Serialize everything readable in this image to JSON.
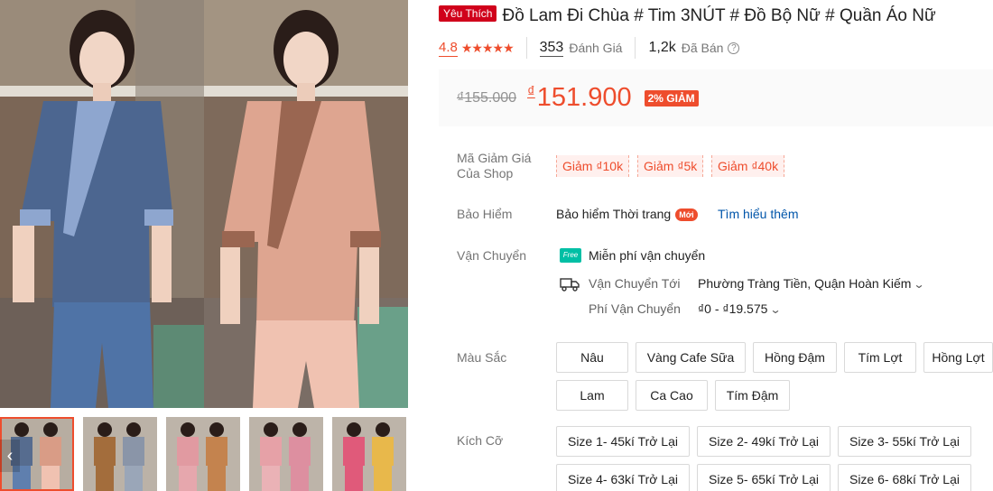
{
  "gallery": {
    "thumb_prev_icon": "chevron-left-icon",
    "thumbnails": [
      {
        "colors": [
          "#566c8f",
          "#d99c86"
        ]
      },
      {
        "colors": [
          "#a36d3c",
          "#8a95a8"
        ]
      },
      {
        "colors": [
          "#e19aa1",
          "#c4834e"
        ]
      },
      {
        "colors": [
          "#e6a1a7",
          "#dd8fa0"
        ]
      },
      {
        "colors": [
          "#e05a7a",
          "#e8b84b"
        ]
      }
    ],
    "main_colors": {
      "left": "#4c6690",
      "right": "#dea590"
    }
  },
  "product": {
    "favorite_badge": "Yêu Thích",
    "title": "Đồ Lam Đi Chùa # Tim 3NÚT # Đồ Bộ Nữ # Quần Áo Nữ",
    "rating": "4.8",
    "stars": "★★★★★",
    "review_count": "353",
    "review_label": "Đánh Giá",
    "sold_count": "1,2k",
    "sold_label": "Đã Bán",
    "help_icon": "?"
  },
  "price": {
    "old": "₫155.000",
    "currency": "₫",
    "new": "151.900",
    "discount": "2% GIẢM"
  },
  "vouchers": {
    "label_line1": "Mã Giảm Giá",
    "label_line2": "Của Shop",
    "items": [
      "Giảm ₫10k",
      "Giảm ₫5k",
      "Giảm ₫40k"
    ]
  },
  "insurance": {
    "label": "Bảo Hiểm",
    "text": "Bảo hiểm Thời trang",
    "badge": "Mới",
    "link": "Tìm hiểu thêm"
  },
  "shipping": {
    "label": "Vận Chuyển",
    "free_icon_text": "Free",
    "free_text": "Miễn phí vận chuyển",
    "to_label": "Vận Chuyển Tới",
    "to_value": "Phường Tràng Tiền, Quận Hoàn Kiếm",
    "fee_label": "Phí Vận Chuyển",
    "fee_value": "₫0 - ₫19.575",
    "accent": "#00bfa5"
  },
  "colors": {
    "label": "Màu Sắc",
    "options": [
      "Nâu",
      "Vàng Cafe Sữa",
      "Hồng Đậm",
      "Tím Lợt",
      "Hồng Lợt",
      "Lam",
      "Ca Cao",
      "Tím Đậm"
    ]
  },
  "sizes": {
    "label": "Kích Cỡ",
    "options": [
      "Size 1- 45kí Trở Lại",
      "Size 2- 49kí Trở Lại",
      "Size 3- 55kí Trở Lại",
      "Size 4- 63kí Trở Lại",
      "Size 5- 65kí Trở Lại",
      "Size 6- 68kí Trở Lại"
    ]
  },
  "theme": {
    "accent": "#ee4d2d",
    "link": "#0055aa"
  }
}
